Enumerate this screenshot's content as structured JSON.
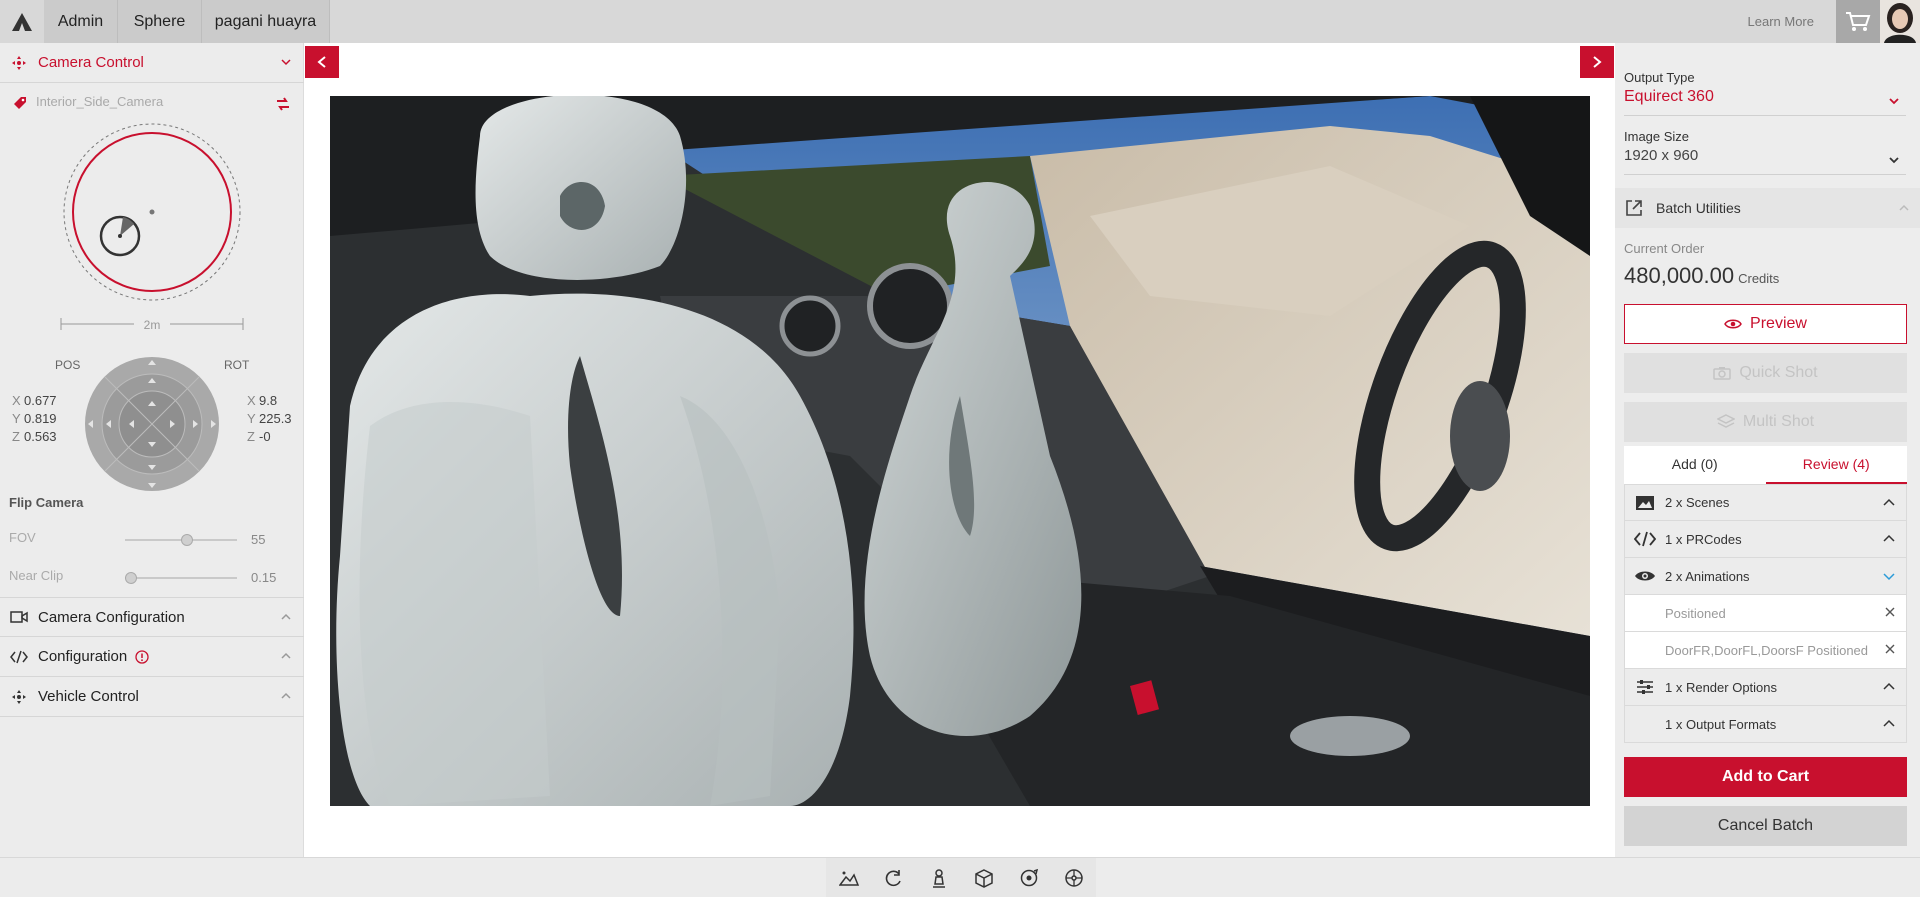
{
  "topbar": {
    "tabs": [
      "Admin",
      "Sphere",
      "pagani huayra"
    ],
    "learn_more": "Learn More"
  },
  "left": {
    "camera_control": "Camera Control",
    "camera_name": "Interior_Side_Camera",
    "distance": "2m",
    "pos_label": "POS",
    "rot_label": "ROT",
    "pos": {
      "x": "0.677",
      "y": "0.819",
      "z": "0.563"
    },
    "rot": {
      "x": "9.8",
      "y": "225.3",
      "z": "-0"
    },
    "flip_camera": "Flip Camera",
    "fov_label": "FOV",
    "fov_value": "55",
    "fov_fraction": 0.55,
    "near_label": "Near Clip",
    "near_value": "0.15",
    "near_fraction": 0.05,
    "camera_configuration": "Camera Configuration",
    "configuration": "Configuration",
    "vehicle_control": "Vehicle Control"
  },
  "right": {
    "output_type_label": "Output Type",
    "output_type_value": "Equirect 360",
    "image_size_label": "Image Size",
    "image_size_value": "1920 x 960",
    "batch_utilities": "Batch Utilities",
    "current_order_label": "Current Order",
    "credits_value": "480,000.00",
    "credits_unit": "Credits",
    "preview": "Preview",
    "quick_shot": "Quick Shot",
    "multi_shot": "Multi Shot",
    "tab_add": "Add (0)",
    "tab_review": "Review (4)",
    "review_items": [
      {
        "label": "2 x Scenes"
      },
      {
        "label": "1 x PRCodes"
      },
      {
        "label": "2 x Animations"
      },
      {
        "label": "Positioned"
      },
      {
        "label": "DoorFR,DoorFL,DoorsF Positioned"
      },
      {
        "label": "1 x Render Options"
      },
      {
        "label": "1 x Output Formats"
      }
    ],
    "add_to_cart": "Add to Cart",
    "cancel_batch": "Cancel Batch"
  },
  "colors": {
    "accent": "#c8102e",
    "panel": "#ececec"
  }
}
